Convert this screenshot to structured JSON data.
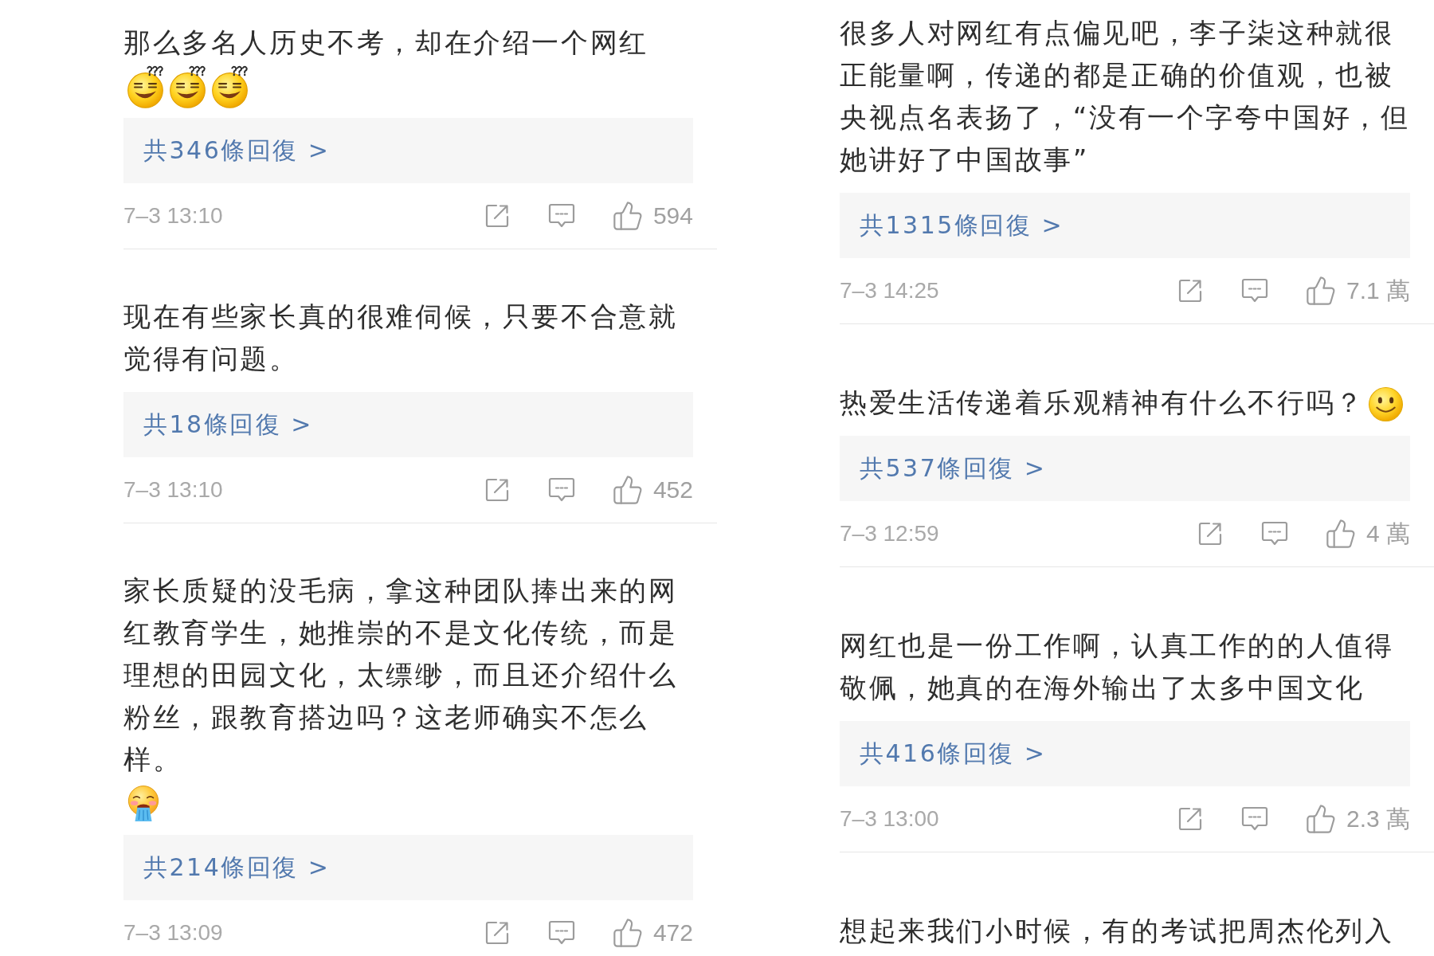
{
  "columns": [
    {
      "comments": [
        {
          "text": "那么多名人历史不考，却在介绍一个网红",
          "emojis": [
            {
              "kind": "confused"
            },
            {
              "kind": "confused"
            },
            {
              "kind": "confused"
            }
          ],
          "replies": "共346條回復 >",
          "time": "7–3 13:10",
          "likes": "594"
        },
        {
          "text": "现在有些家长真的很难伺候，只要不合意就觉得有问题。",
          "replies": "共18條回復 >",
          "time": "7–3 13:10",
          "likes": "452"
        },
        {
          "text": "家长质疑的没毛病，拿这种团队捧出来的网红教育学生，她推崇的不是文化传统，而是理想的田园文化，太缥缈，而且还介绍什么粉丝，跟教育搭边吗？这老师确实不怎么样。",
          "emojis": [
            {
              "kind": "vomiting"
            }
          ],
          "replies": "共214條回復 >",
          "time": "7–3 13:09",
          "likes": "472"
        }
      ]
    },
    {
      "comments": [
        {
          "text": "很多人对网红有点偏见吧，李子柒这种就很正能量啊，传递的都是正确的价值观，也被央视点名表扬了，“没有一个字夸中国好，但她讲好了中国故事”",
          "replies": "共1315條回復 >",
          "time": "7–3 14:25",
          "likes": "7.1 萬"
        },
        {
          "text": "热爱生活传递着乐观精神有什么不行吗？",
          "emojis": [
            {
              "kind": "smiling"
            }
          ],
          "replies": "共537條回復 >",
          "time": "7–3 12:59",
          "likes": "4 萬"
        },
        {
          "text": "网红也是一份工作啊，认真工作的的人值得敬佩，她真的在海外输出了太多中国文化",
          "replies": "共416條回復 >",
          "time": "7–3 13:00",
          "likes": "2.3 萬"
        },
        {
          "text": "想起来我们小时候，有的考试把周杰伦列入"
        }
      ]
    }
  ]
}
